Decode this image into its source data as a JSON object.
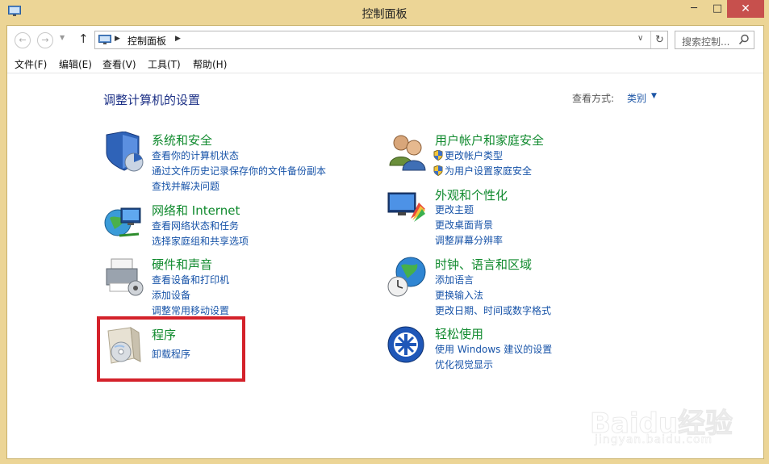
{
  "window": {
    "title": "控制面板"
  },
  "titlebar": {
    "min": "─",
    "max": "□",
    "close": "✕"
  },
  "nav": {
    "back": "←",
    "forward": "→",
    "recent": "▼",
    "up": "↑",
    "address_sep": "▶",
    "address": "控制面板",
    "dropdown": "∨",
    "refresh": "↻",
    "search_placeholder": "搜索控制..."
  },
  "menu": {
    "file": "文件(F)",
    "edit": "编辑(E)",
    "view": "查看(V)",
    "tools": "工具(T)",
    "help": "帮助(H)"
  },
  "content": {
    "heading": "调整计算机的设置",
    "view_by_label": "查看方式:",
    "view_by_value": "类别",
    "view_by_caret": "▼"
  },
  "categories": {
    "system": {
      "title": "系统和安全",
      "links": [
        "查看你的计算机状态",
        "通过文件历史记录保存你的文件备份副本",
        "查找并解决问题"
      ]
    },
    "network": {
      "title": "网络和 Internet",
      "links": [
        "查看网络状态和任务",
        "选择家庭组和共享选项"
      ]
    },
    "hardware": {
      "title": "硬件和声音",
      "links": [
        "查看设备和打印机",
        "添加设备",
        "调整常用移动设置"
      ]
    },
    "programs": {
      "title": "程序",
      "links": [
        "卸载程序"
      ]
    },
    "users": {
      "title": "用户帐户和家庭安全",
      "links": [
        "更改帐户类型",
        "为用户设置家庭安全"
      ]
    },
    "appearance": {
      "title": "外观和个性化",
      "links": [
        "更改主题",
        "更改桌面背景",
        "调整屏幕分辨率"
      ]
    },
    "clock": {
      "title": "时钟、语言和区域",
      "links": [
        "添加语言",
        "更换输入法",
        "更改日期、时间或数字格式"
      ]
    },
    "ease": {
      "title": "轻松使用",
      "links": [
        "使用 Windows 建议的设置",
        "优化视觉显示"
      ]
    }
  },
  "watermark": {
    "text": "Baidu经验",
    "sub": "jingyan.baidu.com"
  },
  "colors": {
    "accent_title": "#108a2e",
    "link": "#1753a8",
    "heading": "#1e3287",
    "highlight": "#d4212a",
    "frame": "#ecd596"
  }
}
